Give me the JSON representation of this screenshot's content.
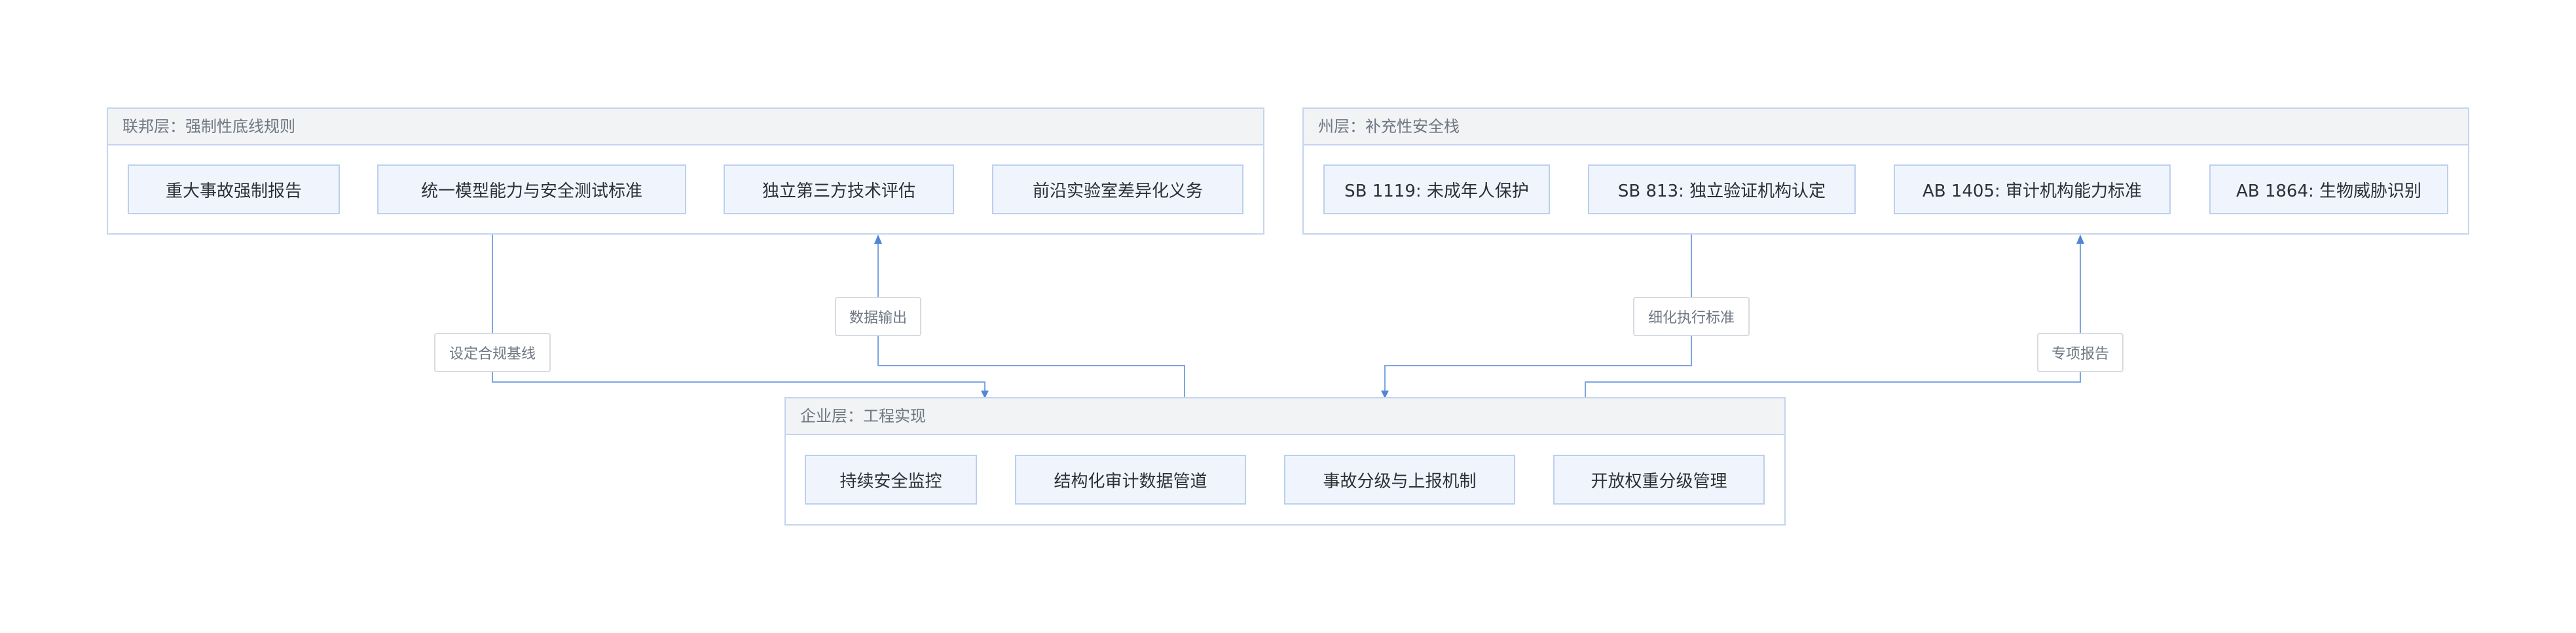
{
  "federal": {
    "title": "联邦层：强制性底线规则",
    "items": [
      "重大事故强制报告",
      "统一模型能力与安全测试标准",
      "独立第三方技术评估",
      "前沿实验室差异化义务"
    ]
  },
  "state": {
    "title": "州层：补充性安全栈",
    "items": [
      "SB 1119: 未成年人保护",
      "SB 813: 独立验证机构认定",
      "AB 1405: 审计机构能力标准",
      "AB 1864: 生物威胁识别"
    ]
  },
  "enterprise": {
    "title": "企业层：工程实现",
    "items": [
      "持续安全监控",
      "结构化审计数据管道",
      "事故分级与上报机制",
      "开放权重分级管理"
    ]
  },
  "edges": {
    "set_baseline": "设定合规基线",
    "data_output": "数据输出",
    "refine_standards": "细化执行标准",
    "special_report": "专项报告"
  },
  "colors": {
    "connector": "#5b8fd9",
    "border": "#c5d5ef",
    "node_fill": "#f0f5fd",
    "header_fill": "#f2f3f5"
  }
}
